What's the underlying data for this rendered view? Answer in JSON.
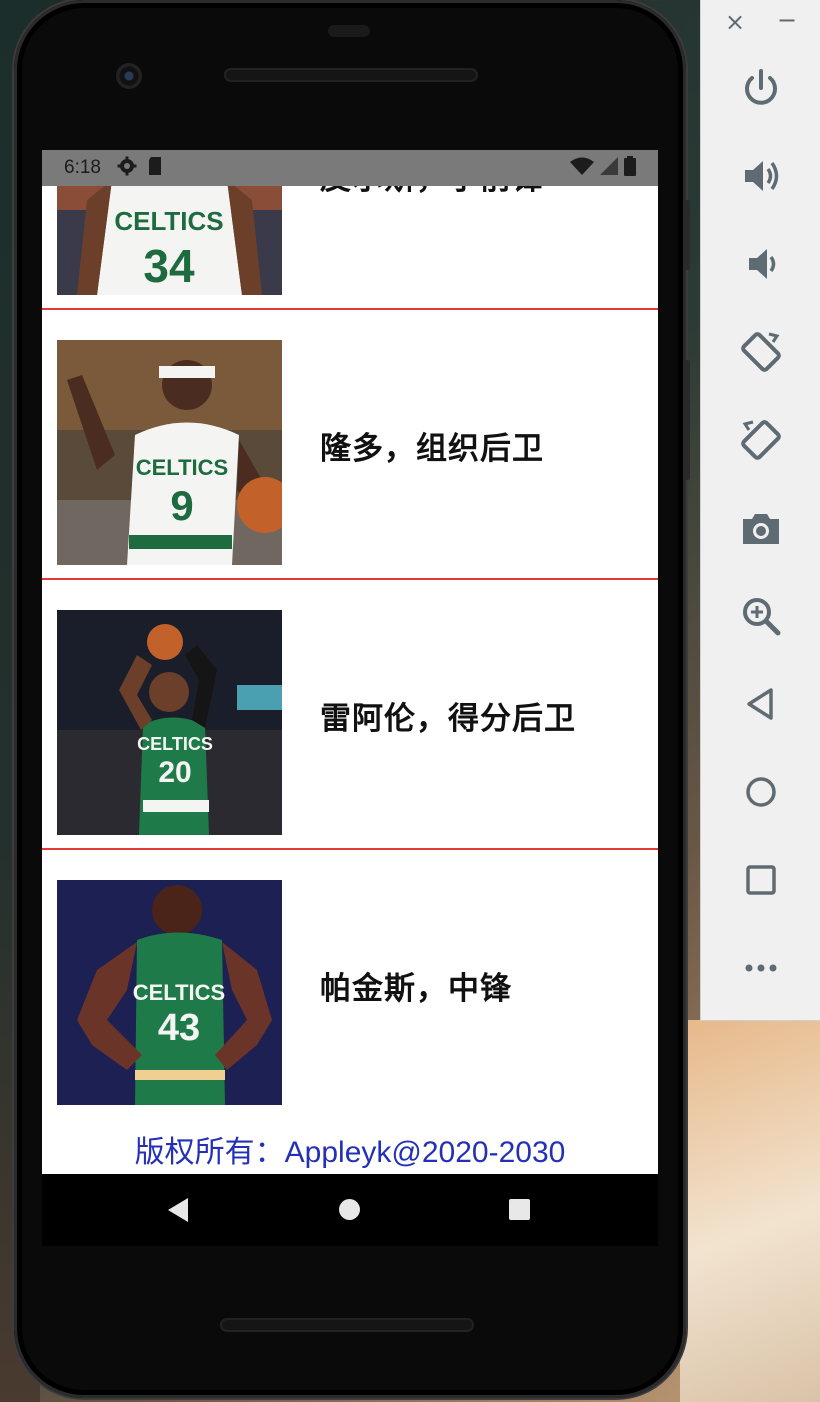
{
  "status_bar": {
    "time": "6:18"
  },
  "players": [
    {
      "label": "皮尔斯，小前锋",
      "jersey_number": "34",
      "jersey_color": "#ffffff"
    },
    {
      "label": "隆多，组织后卫",
      "jersey_number": "9",
      "jersey_color": "#ffffff"
    },
    {
      "label": "雷阿伦，得分后卫",
      "jersey_number": "20",
      "jersey_color": "#1f7a4a"
    },
    {
      "label": "帕金斯，中锋",
      "jersey_number": "43",
      "jersey_color": "#1f7a4a"
    }
  ],
  "jersey_text": "CELTICS",
  "footer": {
    "text": "版权所有：Appleyk@2020-2030"
  },
  "emulator_panel": {
    "close_label": "×",
    "minimize_label": "−",
    "tools": [
      "power-icon",
      "volume-up-icon",
      "volume-down-icon",
      "rotate-left-icon",
      "rotate-right-icon",
      "camera-icon",
      "zoom-icon",
      "back-icon",
      "home-icon",
      "overview-icon",
      "more-icon"
    ]
  },
  "colors": {
    "divider": "#e53935",
    "footer_text": "#2431b6",
    "status_bar": "#7a7a7a",
    "panel_icon": "#5f6b73"
  }
}
